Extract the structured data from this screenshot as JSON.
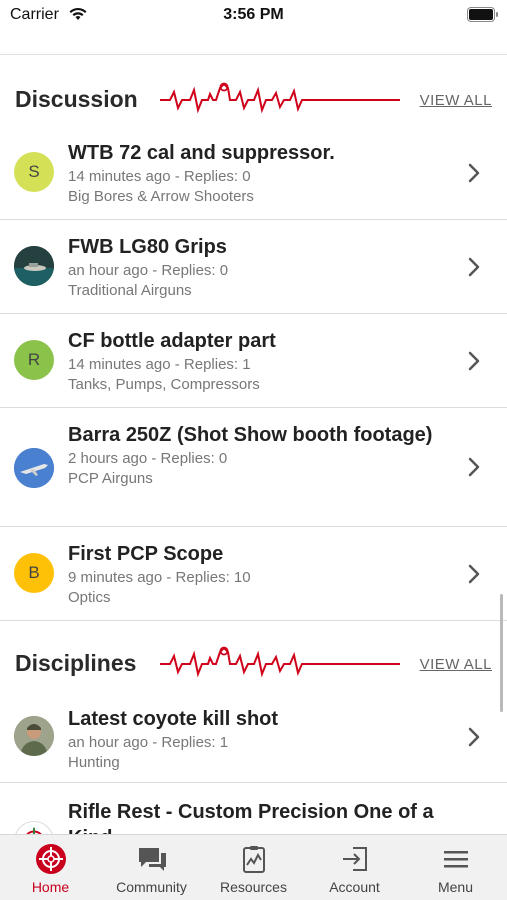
{
  "status_bar": {
    "carrier": "Carrier",
    "time": "3:56 PM"
  },
  "colors": {
    "accent": "#c8001e",
    "divider": "#dcdcdc",
    "meta_text": "#777777"
  },
  "discussion": {
    "title": "Discussion",
    "view_all": "VIEW ALL",
    "items": [
      {
        "avatar_letter": "S",
        "avatar_color": "#d4e157",
        "title": "WTB 72 cal and suppressor.",
        "meta": "14 minutes ago - Replies: 0",
        "forum": "Big Bores & Arrow Shooters"
      },
      {
        "avatar_letter": "",
        "avatar_color": "#2d3b3a",
        "avatar_image": "photo-boat-water",
        "title": "FWB LG80 Grips",
        "meta": "an hour ago - Replies: 0",
        "forum": "Traditional Airguns"
      },
      {
        "avatar_letter": "R",
        "avatar_color": "#8bc34a",
        "title": "CF bottle adapter part",
        "meta": "14 minutes ago - Replies: 1",
        "forum": "Tanks, Pumps, Compressors"
      },
      {
        "avatar_letter": "",
        "avatar_color": "#3f6fbf",
        "avatar_image": "photo-airplane",
        "title": "Barra 250Z (Shot Show booth footage)",
        "meta": "2 hours ago - Replies: 0",
        "forum": "PCP Airguns"
      },
      {
        "avatar_letter": "B",
        "avatar_color": "#ffc107",
        "title": "First PCP Scope",
        "meta": "9 minutes ago - Replies: 10",
        "forum": "Optics"
      }
    ]
  },
  "disciplines": {
    "title": "Disciplines",
    "view_all": "VIEW ALL",
    "items": [
      {
        "avatar_letter": "",
        "avatar_color": "#8a8f7a",
        "avatar_image": "photo-person",
        "title": "Latest coyote kill shot",
        "meta": "an hour ago - Replies: 1",
        "forum": "Hunting"
      },
      {
        "avatar_letter": "",
        "avatar_color": "#ffffff",
        "avatar_image": "logo-crosshair",
        "title": "Rifle Rest - Custom Precision One of a Kind",
        "meta": "",
        "forum": ""
      }
    ]
  },
  "tab_bar": {
    "tabs": [
      {
        "label": "Home",
        "icon": "crosshair-icon",
        "active": true
      },
      {
        "label": "Community",
        "icon": "chat-bubbles-icon",
        "active": false
      },
      {
        "label": "Resources",
        "icon": "clipboard-chart-icon",
        "active": false
      },
      {
        "label": "Account",
        "icon": "sign-in-icon",
        "active": false
      },
      {
        "label": "Menu",
        "icon": "hamburger-icon",
        "active": false
      }
    ]
  }
}
